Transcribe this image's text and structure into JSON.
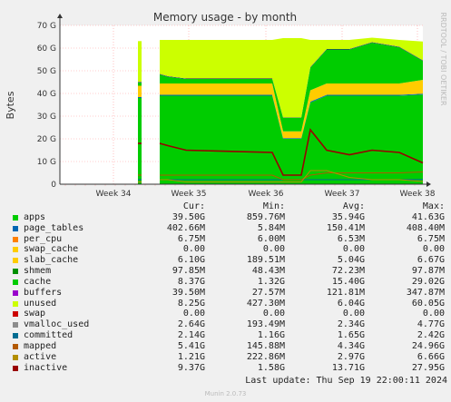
{
  "chart_data": {
    "type": "area",
    "title": "Memory usage - by month",
    "ylabel": "Bytes",
    "ylim": [
      0,
      70
    ],
    "yunit": "G",
    "yticks": [
      "0",
      "10 G",
      "20 G",
      "30 G",
      "40 G",
      "50 G",
      "60 G",
      "70 G"
    ],
    "xticks": [
      "Week 34",
      "Week 35",
      "Week 36",
      "Week 37",
      "Week 38"
    ],
    "grid": true,
    "stacked_order": [
      "apps",
      "page_tables",
      "per_cpu",
      "swap_cache",
      "slab_cache",
      "cache",
      "buffers",
      "unused",
      "swap",
      "committed",
      "mapped",
      "active",
      "inactive"
    ],
    "x": [
      "Aug 19",
      "Aug 23",
      "Aug 24",
      "Aug 25",
      "Aug 27",
      "Aug 28",
      "Aug 31",
      "Sep 3",
      "Sep 4",
      "Sep 5",
      "Sep 6",
      "Sep 8",
      "Sep 11",
      "Sep 14",
      "Sep 17",
      "Sep 19"
    ],
    "stacks": [
      {
        "name": "apps",
        "values": [
          null,
          38,
          38,
          null,
          39,
          39,
          39,
          39,
          20,
          20,
          36,
          39,
          39,
          39,
          39,
          39.5
        ]
      },
      {
        "name": "page_tables",
        "values": [
          null,
          0.4,
          0.4,
          null,
          0.4,
          0.4,
          0.4,
          0.4,
          0.3,
          0.3,
          0.4,
          0.4,
          0.4,
          0.4,
          0.4,
          0.4
        ]
      },
      {
        "name": "slab_cache",
        "values": [
          null,
          5,
          5,
          null,
          5,
          5,
          5,
          5,
          3,
          3,
          5,
          5,
          5,
          5,
          5,
          6.1
        ]
      },
      {
        "name": "cache",
        "values": [
          null,
          1.5,
          1.5,
          null,
          4,
          3,
          2,
          2,
          6,
          6,
          10,
          15,
          15,
          18,
          16,
          8.4
        ]
      },
      {
        "name": "buffers",
        "values": [
          null,
          0.2,
          0.2,
          null,
          0.2,
          0.2,
          0.2,
          0.2,
          0.1,
          0.1,
          0.2,
          0.2,
          0.2,
          0.2,
          0.2,
          0.2
        ]
      },
      {
        "name": "unused",
        "values": [
          null,
          18,
          18,
          null,
          15,
          16,
          17,
          17,
          35,
          35,
          12,
          4,
          4,
          2,
          3,
          8.3
        ]
      }
    ],
    "lines": [
      {
        "name": "committed",
        "values": [
          null,
          2,
          2,
          null,
          2,
          2,
          2,
          2,
          2,
          2,
          2,
          2,
          2,
          2,
          2,
          2.1
        ]
      },
      {
        "name": "mapped",
        "values": [
          null,
          4,
          4,
          null,
          4,
          4,
          4,
          4,
          2,
          2,
          4,
          5,
          5,
          5,
          5,
          5.4
        ]
      },
      {
        "name": "active",
        "values": [
          null,
          1,
          1,
          null,
          2,
          2,
          1,
          1,
          1,
          1,
          6,
          6,
          3,
          2,
          2,
          1.2
        ]
      },
      {
        "name": "inactive",
        "values": [
          null,
          18,
          18,
          null,
          18,
          17,
          15,
          14,
          4,
          4,
          24,
          15,
          13,
          15,
          14,
          9.4
        ]
      }
    ],
    "legend": {
      "headers": [
        "Cur:",
        "Min:",
        "Avg:",
        "Max:"
      ],
      "rows": [
        {
          "name": "apps",
          "color": "#00cc00",
          "cur": "39.50G",
          "min": "859.76M",
          "avg": "35.94G",
          "max": "41.63G"
        },
        {
          "name": "page_tables",
          "color": "#0066b3",
          "cur": "402.66M",
          "min": "5.84M",
          "avg": "150.41M",
          "max": "408.40M"
        },
        {
          "name": "per_cpu",
          "color": "#ff8000",
          "cur": "6.75M",
          "min": "6.00M",
          "avg": "6.53M",
          "max": "6.75M"
        },
        {
          "name": "swap_cache",
          "color": "#ffcc00",
          "cur": "0.00",
          "min": "0.00",
          "avg": "0.00",
          "max": "0.00"
        },
        {
          "name": "slab_cache",
          "color": "#ffcc00",
          "cur": "6.10G",
          "min": "189.51M",
          "avg": "5.04G",
          "max": "6.67G"
        },
        {
          "name": "shmem",
          "color": "#008f00",
          "cur": "97.85M",
          "min": "48.43M",
          "avg": "72.23M",
          "max": "97.87M"
        },
        {
          "name": "cache",
          "color": "#00cc00",
          "cur": "8.37G",
          "min": "1.32G",
          "avg": "15.40G",
          "max": "29.02G"
        },
        {
          "name": "buffers",
          "color": "#9900cc",
          "cur": "39.50M",
          "min": "27.57M",
          "avg": "121.81M",
          "max": "347.87M"
        },
        {
          "name": "unused",
          "color": "#ccff00",
          "cur": "8.25G",
          "min": "427.30M",
          "avg": "6.04G",
          "max": "60.05G"
        },
        {
          "name": "swap",
          "color": "#cc0000",
          "cur": "0.00",
          "min": "0.00",
          "avg": "0.00",
          "max": "0.00"
        },
        {
          "name": "vmalloc_used",
          "color": "#8c8c8c",
          "cur": "2.64G",
          "min": "193.49M",
          "avg": "2.34G",
          "max": "4.77G"
        },
        {
          "name": "committed",
          "color": "#006c91",
          "cur": "2.14G",
          "min": "1.16G",
          "avg": "1.65G",
          "max": "2.42G"
        },
        {
          "name": "mapped",
          "color": "#b35a00",
          "cur": "5.41G",
          "min": "145.88M",
          "avg": "4.34G",
          "max": "24.96G"
        },
        {
          "name": "active",
          "color": "#b38f00",
          "cur": "1.21G",
          "min": "222.86M",
          "avg": "2.97G",
          "max": "6.66G"
        },
        {
          "name": "inactive",
          "color": "#990000",
          "cur": "9.37G",
          "min": "1.58G",
          "avg": "13.71G",
          "max": "27.95G"
        }
      ]
    }
  },
  "colors": {
    "apps": "#00cc00",
    "page_tables": "#0066b3",
    "slab_cache": "#ffcc00",
    "cache": "#00cc00",
    "buffers": "#330099",
    "unused": "#ccff00",
    "committed": "#006c91",
    "mapped": "#b35a00",
    "active": "#b38f00",
    "inactive": "#990000"
  },
  "side_text": "RRDTOOL / TOBI OETIKER",
  "footer": "Last update: Thu Sep 19 22:00:11 2024",
  "munin": "Munin 2.0.73"
}
